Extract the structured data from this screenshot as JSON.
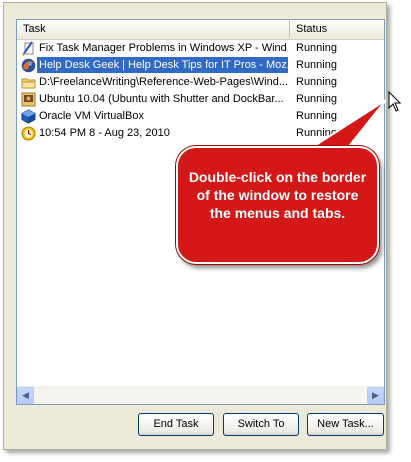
{
  "header": {
    "task": "Task",
    "status": "Status"
  },
  "tasks": [
    {
      "name": "Fix Task Manager Problems in Windows XP - Wind...",
      "status": "Running",
      "icon": "document-pen-icon",
      "selected": false
    },
    {
      "name": "Help Desk Geek | Help Desk Tips for IT Pros - Moz...",
      "status": "Running",
      "icon": "firefox-icon",
      "selected": true
    },
    {
      "name": "D:\\FreelanceWriting\\Reference-Web-Pages\\Wind...",
      "status": "Running",
      "icon": "folder-icon",
      "selected": false
    },
    {
      "name": "Ubuntu 10.04 (Ubuntu with Shutter and DockBar...",
      "status": "Running",
      "icon": "virtualbox-vm-icon",
      "selected": false
    },
    {
      "name": "Oracle VM VirtualBox",
      "status": "Running",
      "icon": "virtualbox-icon",
      "selected": false
    },
    {
      "name": "10:54 PM 8 - Aug 23, 2010",
      "status": "Running",
      "icon": "clock-icon",
      "selected": false
    }
  ],
  "buttons": {
    "end_task": "End Task",
    "switch_to": "Switch To",
    "new_task": "New Task..."
  },
  "callout": {
    "text": "Double-click on the border of the window to restore the menus and tabs.",
    "color": "#d41717"
  },
  "colors": {
    "selection": "#316ac5",
    "window_bg": "#ece9d8"
  }
}
